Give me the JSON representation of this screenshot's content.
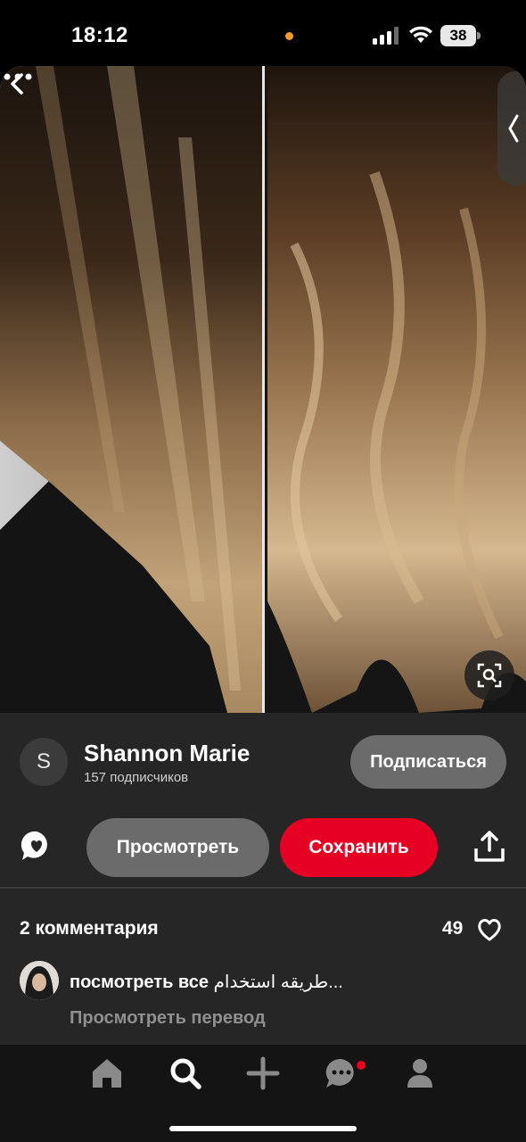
{
  "status_bar": {
    "time": "18:12",
    "battery": "38"
  },
  "pin": {
    "image_description_icon": "hair-photo",
    "author": {
      "initial": "S",
      "name": "Shannon Marie",
      "followers": "157 подписчиков"
    },
    "follow_label": "Подписаться",
    "view_label": "Просмотреть",
    "save_label": "Сохранить"
  },
  "comments": {
    "title": "2 комментария",
    "likes": "49",
    "first": {
      "see_all": "посмотреть все",
      "text": "طريقه استخدام...",
      "translate": "Просмотреть перевод"
    }
  },
  "colors": {
    "accent": "#e60023",
    "panel": "#262626",
    "button_gray": "#6b6b6b"
  },
  "icons": {
    "back": "chevron-left-icon",
    "more": "more-icon",
    "lens": "visual-search-icon",
    "share": "chat-share-icon",
    "upload": "upload-icon",
    "like": "heart-icon",
    "nav": [
      "home-icon",
      "search-icon",
      "plus-icon",
      "messages-icon",
      "profile-icon"
    ]
  }
}
